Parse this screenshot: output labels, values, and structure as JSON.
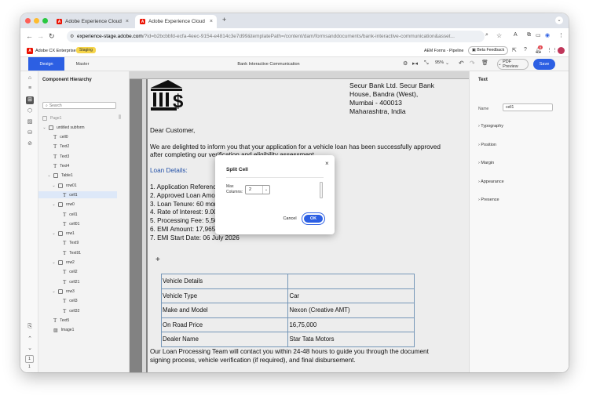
{
  "browser": {
    "tabs": [
      {
        "label": "Adobe Experience Cloud",
        "active": false
      },
      {
        "label": "Adobe Experience Cloud",
        "active": true
      }
    ],
    "url_host": "experience-stage.adobe.com",
    "url_path": "/?id=b2bcbbfd-ecfa-4eec-9154-e4814c3e7d99&templatePath=/content/dam/formsanddocuments/bank-interactive-communication&asset..."
  },
  "aem": {
    "product": "Adobe CX Enterprise",
    "env_badge": "Staging",
    "pipeline": "AEM Forms - Pipeline",
    "beta_feedback": "Beta Feedback",
    "notif_count": "9"
  },
  "toolbar": {
    "design_tab": "Design",
    "master_tab": "Master",
    "doc_title": "Bank Interactive Communication",
    "zoom": "95%",
    "pdf_preview": "PDF Preview",
    "save": "Save"
  },
  "hierarchy": {
    "title": "Component Hierarchy",
    "search_placeholder": "Search",
    "items": [
      {
        "label": "Page1",
        "indent": 0,
        "kind": "box",
        "caret": false,
        "dim": true
      },
      {
        "label": "untitled subform",
        "indent": 0,
        "kind": "box",
        "caret": true
      },
      {
        "label": "cell0",
        "indent": 1,
        "kind": "text"
      },
      {
        "label": "Text2",
        "indent": 1,
        "kind": "text"
      },
      {
        "label": "Text3",
        "indent": 1,
        "kind": "text"
      },
      {
        "label": "Text4",
        "indent": 1,
        "kind": "text"
      },
      {
        "label": "Table1",
        "indent": 1,
        "kind": "box",
        "caret": true
      },
      {
        "label": "row01",
        "indent": 2,
        "kind": "box",
        "caret": true
      },
      {
        "label": "cell1",
        "indent": 3,
        "kind": "text",
        "selected": true
      },
      {
        "label": "row0",
        "indent": 2,
        "kind": "box",
        "caret": true
      },
      {
        "label": "cell1",
        "indent": 3,
        "kind": "text"
      },
      {
        "label": "cell01",
        "indent": 3,
        "kind": "text"
      },
      {
        "label": "row1",
        "indent": 2,
        "kind": "box",
        "caret": true
      },
      {
        "label": "Text9",
        "indent": 3,
        "kind": "text"
      },
      {
        "label": "Text91",
        "indent": 3,
        "kind": "text"
      },
      {
        "label": "row2",
        "indent": 2,
        "kind": "box",
        "caret": true
      },
      {
        "label": "cell2",
        "indent": 3,
        "kind": "text"
      },
      {
        "label": "cell21",
        "indent": 3,
        "kind": "text"
      },
      {
        "label": "row3",
        "indent": 2,
        "kind": "box",
        "caret": true
      },
      {
        "label": "cell3",
        "indent": 3,
        "kind": "text"
      },
      {
        "label": "cell32",
        "indent": 3,
        "kind": "text"
      },
      {
        "label": "Text5",
        "indent": 1,
        "kind": "text"
      },
      {
        "label": "Image1",
        "indent": 1,
        "kind": "image"
      }
    ]
  },
  "document": {
    "bank_address": [
      "Secur Bank Ltd. Secur Bank",
      "House, Bandra (West),",
      "Mumbai - 400013",
      "Maharashtra, India"
    ],
    "greeting": "Dear Customer,",
    "intro": [
      "We are delighted to inform you that your application for a vehicle loan has been successfully approved",
      "after completing our verification and eligibility assessment."
    ],
    "loan_heading": "Loan Details:",
    "loan_lines": [
      "1. Application Reference Numb",
      "2. Approved Loan Amount: 12,5",
      "3. Loan Tenure: 60 months",
      "4. Rate of Interest: 9.00% per an",
      "5. Processing Fee: 5,500",
      "6. EMI Amount: 17,965",
      "7. EMI Start Date: 06 July 2026"
    ],
    "vehicle_table": [
      [
        "Vehicle Details",
        ""
      ],
      [
        "Vehicle Type",
        "Car"
      ],
      [
        "Make and Model",
        "Nexon (Creative AMT)"
      ],
      [
        "On Road Price",
        "16,75,000"
      ],
      [
        "Dealer Name",
        "Star Tata Motors"
      ]
    ],
    "closing": [
      "Our Loan Processing Team will contact you within 24-48 hours to guide you through the document",
      "signing process, vehicle verification (if required), and final disbursement."
    ]
  },
  "right_panel": {
    "header": "Text",
    "name_label": "Name",
    "name_value": "cell1",
    "sections": [
      "Typography",
      "Position",
      "Margin",
      "Appearance",
      "Presence"
    ]
  },
  "modal": {
    "title": "Split Cell",
    "field_label": "Max Columns:",
    "field_value": "2",
    "cancel": "Cancel",
    "ok": "OK"
  },
  "rail_page_numbers": [
    "1",
    "1"
  ],
  "colors": {
    "accent": "#2c5fe3",
    "adobe_red": "#eb1000",
    "heading_blue": "#2456b4",
    "staging": "#f6d54a"
  }
}
